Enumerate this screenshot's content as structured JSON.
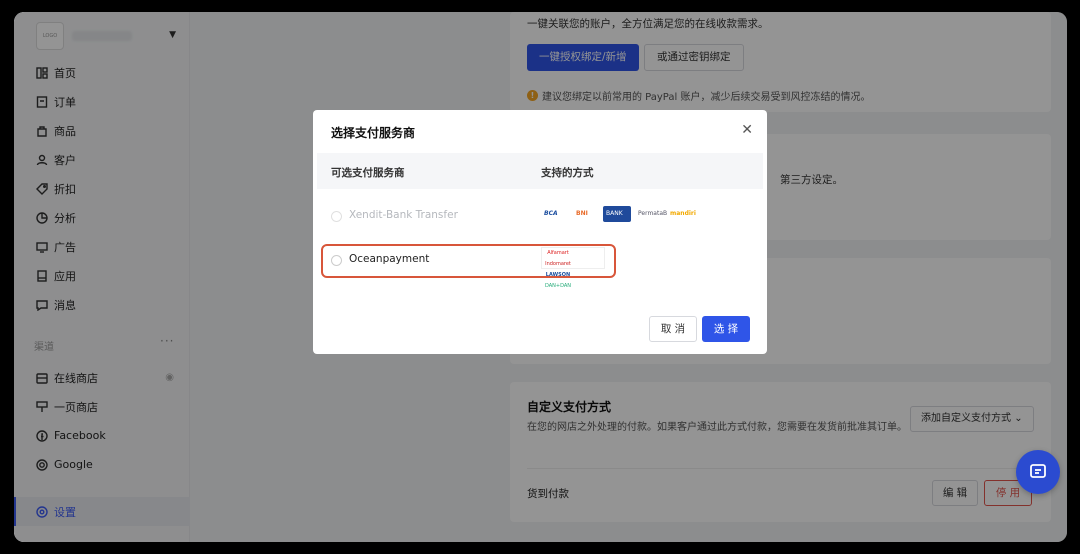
{
  "store": {
    "logo_text": "LOGO"
  },
  "nav": [
    {
      "label": "首页",
      "icon": "home-icon"
    },
    {
      "label": "订单",
      "icon": "orders-icon"
    },
    {
      "label": "商品",
      "icon": "products-icon"
    },
    {
      "label": "客户",
      "icon": "customers-icon"
    },
    {
      "label": "折扣",
      "icon": "discount-icon"
    },
    {
      "label": "分析",
      "icon": "analytics-icon"
    },
    {
      "label": "广告",
      "icon": "ads-icon"
    },
    {
      "label": "应用",
      "icon": "apps-icon"
    },
    {
      "label": "消息",
      "icon": "messages-icon"
    }
  ],
  "channels": {
    "title": "渠道",
    "more": "···",
    "items": [
      {
        "label": "在线商店",
        "icon": "online-store-icon"
      },
      {
        "label": "一页商店",
        "icon": "one-page-store-icon"
      },
      {
        "label": "Facebook",
        "icon": "facebook-icon"
      },
      {
        "label": "Google",
        "icon": "google-icon"
      }
    ]
  },
  "settings": {
    "label": "设置",
    "icon": "settings-icon"
  },
  "paypal": {
    "desc": "一键关联您的账户，全方位满足您的在线收款需求。",
    "primary_btn": "一键授权绑定/新增",
    "secondary_btn": "或通过密钥绑定",
    "warning": "建议您绑定以前常用的 PayPal 账户，减少后续交易受到风控冻结的情况。"
  },
  "card2": {
    "partial": "第三方设定。"
  },
  "custom_payment": {
    "title": "自定义支付方式",
    "desc": "在您的网店之外处理的付款。如果客户通过此方式付款，您需要在发货前批准其订单。",
    "add_btn": "添加自定义支付方式",
    "item": "货到付款",
    "edit_btn": "编 辑",
    "disable_btn": "停 用"
  },
  "modal": {
    "title": "选择支付服务商",
    "col1": "可选支付服务商",
    "col2": "支持的方式",
    "providers": [
      {
        "name": "Xendit-Bank Transfer",
        "logos": [
          "BCA",
          "BNI",
          "BANK BRI",
          "PermataBank",
          "mandiri"
        ]
      },
      {
        "name": "Oceanpayment",
        "logos": [
          "Alfamart",
          "Indomaret",
          "LAWSON",
          "DAN+DAN"
        ]
      }
    ],
    "cancel": "取 消",
    "confirm": "选 择"
  },
  "colors": {
    "primary": "#2f55e8",
    "danger": "#e2554d",
    "highlight": "#d8563a"
  }
}
